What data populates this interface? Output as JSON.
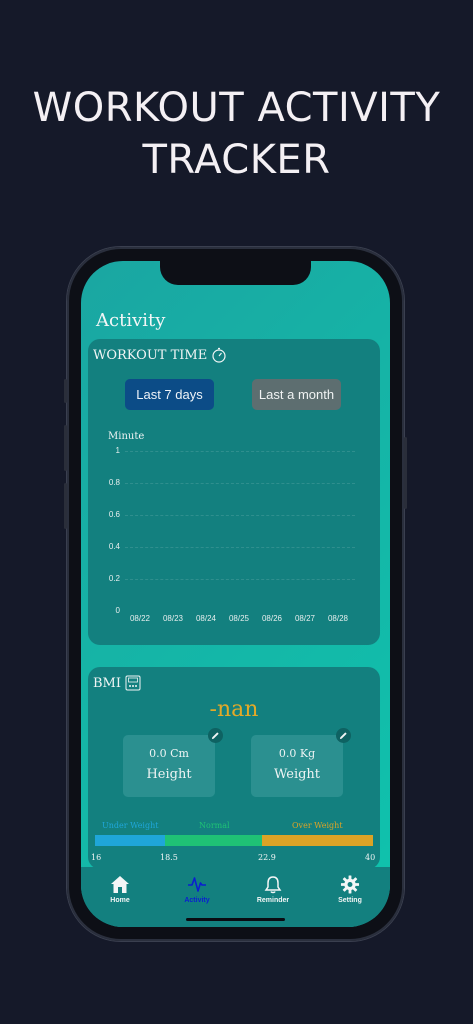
{
  "headline": {
    "line1": "WORKOUT ACTIVITY",
    "line2": "TRACKER"
  },
  "screen": {
    "title": "Activity"
  },
  "workout": {
    "title": "WORKOUT TIME",
    "buttons": {
      "last7": "Last 7 days",
      "lastMonth": "Last a month"
    },
    "chart_title": "Minute"
  },
  "chart_data": {
    "type": "line",
    "ylabel": "Minute",
    "ylim": [
      0,
      1
    ],
    "yticks": [
      "1",
      "0.8",
      "0.6",
      "0.4",
      "0.2",
      "0"
    ],
    "categories": [
      "08/22",
      "08/23",
      "08/24",
      "08/25",
      "08/26",
      "08/27",
      "08/28"
    ],
    "values": [],
    "grid": true
  },
  "bmi": {
    "title": "BMI",
    "value": "-nan",
    "height": {
      "value": "0.0 Cm",
      "label": "Height"
    },
    "weight": {
      "value": "0.0 Kg",
      "label": "Weight"
    },
    "ranges": {
      "under": "Under Weight",
      "normal": "Normal",
      "over": "Over Weight"
    },
    "range_values": [
      "16",
      "18.5",
      "22.9",
      "40"
    ],
    "colors": {
      "under": "#1fa6d9",
      "normal": "#1fc275",
      "over": "#dca326",
      "value": "#e3a928"
    }
  },
  "tabs": [
    {
      "label": "Home",
      "icon": "home-icon"
    },
    {
      "label": "Activity",
      "icon": "activity-icon"
    },
    {
      "label": "Reminder",
      "icon": "bell-icon"
    },
    {
      "label": "Setting",
      "icon": "gear-icon"
    }
  ],
  "accent": "#0a1fd0"
}
